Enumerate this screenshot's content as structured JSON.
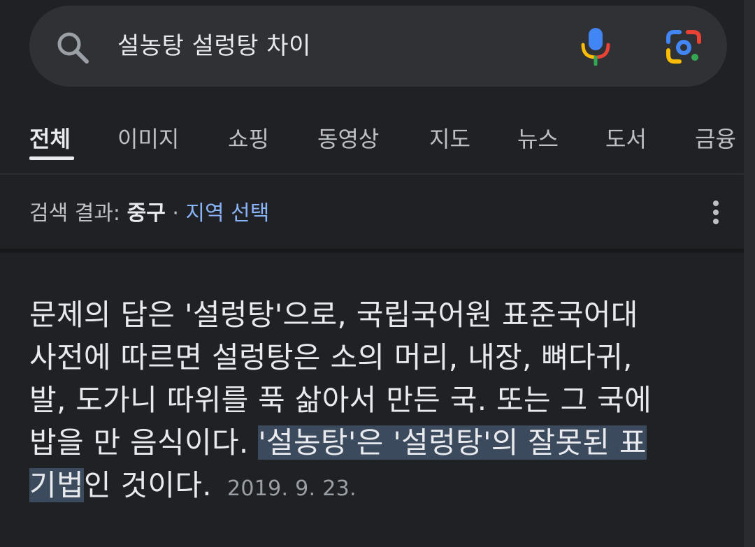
{
  "search": {
    "query": "설농탕 설렁탕 차이"
  },
  "tabs": [
    "전체",
    "이미지",
    "쇼핑",
    "동영상",
    "지도",
    "뉴스",
    "도서",
    "금융"
  ],
  "location": {
    "prefix": "검색 결과: ",
    "place": "중구",
    "separator": " · ",
    "link": "지역 선택"
  },
  "snippet": {
    "line1": "문제의 답은 '설렁탕'으로, 국립국어원 표준국어대",
    "line2": "사전에 따르면 설렁탕은 소의 머리, 내장, 뼈다귀,",
    "line3": "발, 도가니 따위를 푹 삶아서 만든 국. 또는 그 국에",
    "line4_plain": "밥을 만 음식이다. ",
    "line4_highlight": "'설농탕'은 '설렁탕'의 잘못된 표",
    "line5_highlight": "기법",
    "line5_plain": "인 것이다.",
    "date": "2019. 9. 23."
  },
  "colors": {
    "background": "#202124",
    "searchbar": "#303134",
    "link": "#8ab4f8",
    "highlight": "#3c4a5e"
  }
}
